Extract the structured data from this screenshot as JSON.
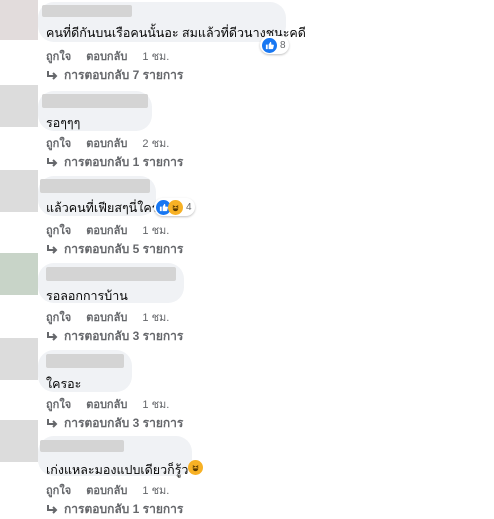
{
  "comments": [
    {
      "text": "คนที่ดีกันบนเรือคนนั้นอะ สมแล้วที่ดีวนางชนะคดี",
      "reactions": {
        "icons": [
          "like-icon"
        ],
        "count": "8"
      },
      "like": "ถูกใจ",
      "reply": "ตอบกลับ",
      "time": "1 ชม.",
      "replies": "การตอบกลับ 7 รายการ"
    },
    {
      "text": "รอๆๆๆ",
      "like": "ถูกใจ",
      "reply": "ตอบกลับ",
      "time": "2 ชม.",
      "replies": "การตอบกลับ 1 รายการ"
    },
    {
      "text": "แล้วคนที่เฟียสๆนี่ใคร",
      "reactions": {
        "icons": [
          "like-icon",
          "haha-icon"
        ],
        "count": "4"
      },
      "like": "ถูกใจ",
      "reply": "ตอบกลับ",
      "time": "1 ชม.",
      "replies": "การตอบกลับ 5 รายการ"
    },
    {
      "text": "รอลอกการบ้าน",
      "like": "ถูกใจ",
      "reply": "ตอบกลับ",
      "time": "1 ชม.",
      "replies": "การตอบกลับ 3 รายการ"
    },
    {
      "text": "ใครอะ",
      "like": "ถูกใจ",
      "reply": "ตอบกลับ",
      "time": "1 ชม.",
      "replies": "การตอบกลับ 3 รายการ"
    },
    {
      "text": "เก่งแหละมองแปบเดียวก็รู้ว",
      "emoji": "haha-emoji",
      "like": "ถูกใจ",
      "reply": "ตอบกลับ",
      "time": "1 ชม.",
      "replies": "การตอบกลับ 1 รายการ"
    }
  ],
  "colors": {
    "bubble": "#f0f2f5",
    "meta": "#65676b",
    "like": "#1877f2",
    "haha": "#f7b125"
  }
}
